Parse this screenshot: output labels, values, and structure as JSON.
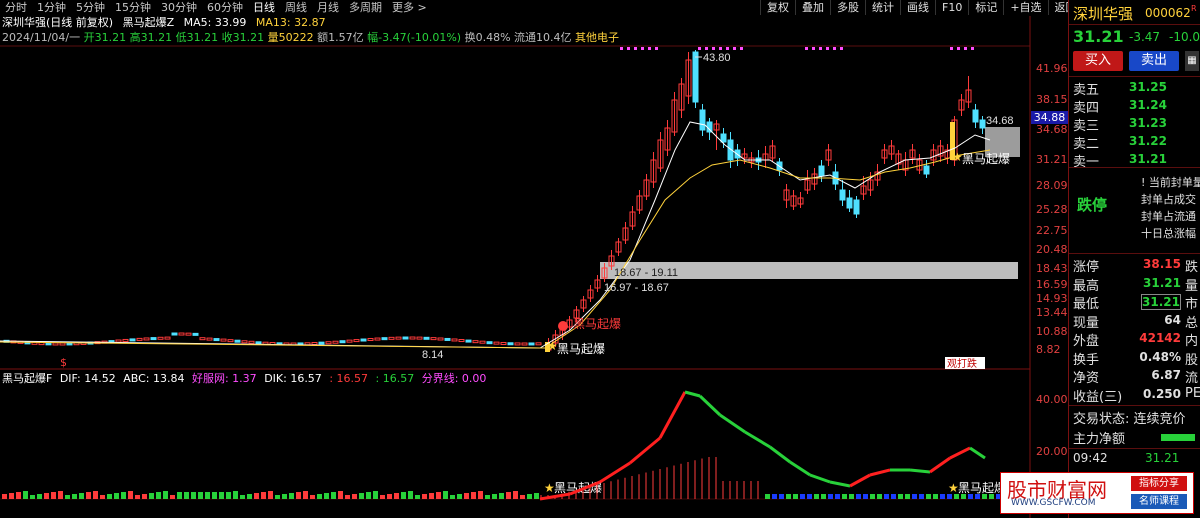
{
  "toolbar": {
    "periods": [
      "分时",
      "1分钟",
      "5分钟",
      "15分钟",
      "30分钟",
      "60分钟",
      "日线",
      "周线",
      "月线",
      "多周期",
      "更多 >"
    ],
    "active_period": "日线",
    "actions": [
      "复权",
      "叠加",
      "多股",
      "统计",
      "画线",
      "F10",
      "标记",
      "+自选",
      "返回"
    ]
  },
  "info_line1": {
    "title": "深圳华强(日线 前复权)",
    "indicator": "黑马起爆Z",
    "ma5": "MA5: 33.99",
    "ma13": "MA13: 32.87"
  },
  "info_line2": {
    "date": "2024/11/04/一",
    "open": "开31.21",
    "high": "高31.21",
    "low": "低31.21",
    "close": "收31.21",
    "volume": "量50222",
    "amount": "额1.57亿",
    "change": "幅-3.47(-10.01%)",
    "turnover": "换0.48%",
    "float_cap": "流通10.4亿",
    "sector": "其他电子"
  },
  "price_axis": [
    "41.96",
    "38.15",
    "34.68",
    "31.21",
    "28.09",
    "25.28",
    "22.75",
    "20.48",
    "18.43",
    "16.59",
    "14.93",
    "13.44",
    "10.88",
    "8.82"
  ],
  "price_tag": "34.88",
  "annotations": {
    "high": "43.80",
    "low": "8.14",
    "last": "34.68",
    "zone1": "18.67 - 19.11",
    "zone2": "16.97 - 18.67",
    "signal": "黑马起爆",
    "bottom_tag": "观打跌"
  },
  "indicator_line": {
    "name": "黑马起爆F",
    "dif": "DIF: 14.52",
    "abc": "ABC: 13.84",
    "hmw": "好服网: 1.37",
    "dik": "DIK: 16.57",
    "v1": ": 16.57",
    "v2": ": 16.57",
    "fjx": "分界线: 0.00"
  },
  "indicator_axis": [
    "40.00",
    "20.00"
  ],
  "right_panel": {
    "stock_name": "深圳华强",
    "stock_code": "000062",
    "badge": "R",
    "price": "31.21",
    "change": "-3.47",
    "change_pct": "-10.01",
    "buy_btn": "买入",
    "sell_btn": "卖出",
    "asks": [
      {
        "label": "卖五",
        "price": "31.25"
      },
      {
        "label": "卖四",
        "price": "31.24"
      },
      {
        "label": "卖三",
        "price": "31.23"
      },
      {
        "label": "卖二",
        "price": "31.22"
      },
      {
        "label": "卖一",
        "price": "31.21"
      }
    ],
    "limit_status": "跌停",
    "limit_notes": [
      "! 当前封单量",
      "封单占成交",
      "封单占流通",
      "十日总涨幅"
    ],
    "stats": [
      {
        "label": "涨停",
        "value": "38.15",
        "suffix": "跌"
      },
      {
        "label": "最高",
        "value": "31.21",
        "suffix": "量"
      },
      {
        "label": "最低",
        "value": "31.21",
        "suffix": "市"
      },
      {
        "label": "现量",
        "value": "64",
        "suffix": "总"
      },
      {
        "label": "外盘",
        "value": "42142",
        "suffix": "内"
      },
      {
        "label": "换手",
        "value": "0.48%",
        "suffix": "股"
      },
      {
        "label": "净资",
        "value": "6.87",
        "suffix": "流"
      },
      {
        "label": "收益(三)",
        "value": "0.250",
        "suffix": "PE"
      }
    ],
    "trade_status": "交易状态: 连续竞价",
    "main_flow": "主力净额",
    "time": "09:42",
    "time_price": "31.21"
  },
  "watermark": {
    "title": "股市财富网",
    "url": "WWW.GSCFW.COM",
    "tag1": "指标分享",
    "tag2": "名师课程"
  },
  "colors": {
    "up": "#ff3b3b",
    "down": "#4fe0ff",
    "ma5": "#ffffff",
    "ma13": "#ffd23c",
    "accent": "#ff4dff"
  }
}
